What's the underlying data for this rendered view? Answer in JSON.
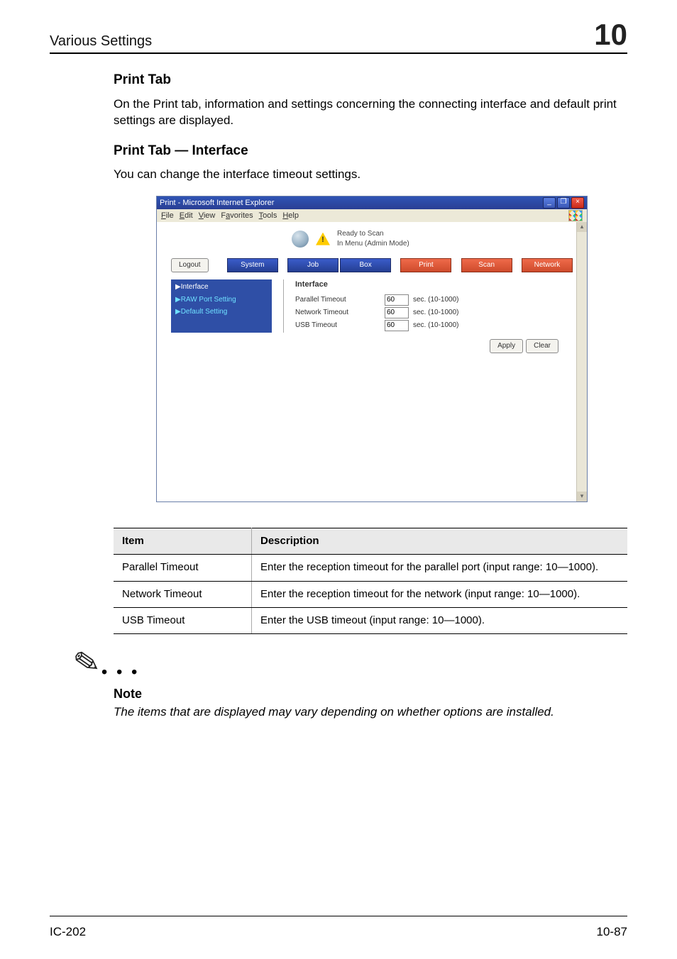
{
  "header": {
    "section": "Various Settings",
    "chapter_number": "10"
  },
  "sections": {
    "print_tab_heading": "Print Tab",
    "print_tab_paragraph": "On the Print tab, information and settings concerning the connecting interface and default print settings are displayed.",
    "print_tab_interface_heading": "Print Tab — Interface",
    "print_tab_interface_paragraph": "You can change the interface timeout settings."
  },
  "screenshot": {
    "window_title": "Print - Microsoft Internet Explorer",
    "menubar": [
      "File",
      "Edit",
      "View",
      "Favorites",
      "Tools",
      "Help"
    ],
    "status": {
      "line1": "Ready to Scan",
      "line2": "In Menu (Admin Mode)"
    },
    "logout_button": "Logout",
    "tabs": {
      "system": "System",
      "job": "Job",
      "box": "Box",
      "print": "Print",
      "scan": "Scan",
      "network": "Network"
    },
    "sidebar": {
      "interface": "▶Interface",
      "raw_port": "▶RAW Port Setting",
      "default_setting": "▶Default Setting"
    },
    "content": {
      "heading": "Interface",
      "rows": [
        {
          "label": "Parallel Timeout",
          "value": "60",
          "unit": "sec. (10-1000)"
        },
        {
          "label": "Network Timeout",
          "value": "60",
          "unit": "sec. (10-1000)"
        },
        {
          "label": "USB Timeout",
          "value": "60",
          "unit": "sec. (10-1000)"
        }
      ],
      "apply": "Apply",
      "clear": "Clear"
    }
  },
  "table": {
    "head_item": "Item",
    "head_desc": "Description",
    "rows": [
      {
        "item": "Parallel Timeout",
        "desc": "Enter the reception timeout for the parallel port (input range: 10—1000)."
      },
      {
        "item": "Network Timeout",
        "desc": "Enter the reception timeout for the network (input range: 10—1000)."
      },
      {
        "item": "USB Timeout",
        "desc": "Enter the USB timeout (input range: 10—1000)."
      }
    ]
  },
  "note": {
    "heading": "Note",
    "text": "The items that are displayed may vary depending on whether options are installed."
  },
  "footer": {
    "left": "IC-202",
    "right": "10-87"
  }
}
